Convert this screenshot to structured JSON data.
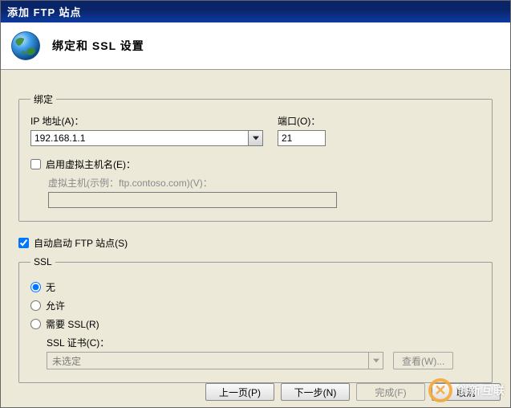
{
  "title": "添加 FTP 站点",
  "header": {
    "title": "绑定和 SSL 设置"
  },
  "binding": {
    "legend": "绑定",
    "ip_label": "IP 地址(A)：",
    "ip_value": "192.168.1.1",
    "port_label": "端口(O)：",
    "port_value": "21",
    "enable_vhost_label": "启用虚拟主机名(E)：",
    "vhost_label": "虚拟主机(示例：ftp.contoso.com)(V)：",
    "vhost_value": ""
  },
  "autostart": {
    "label": "自动启动 FTP 站点(S)"
  },
  "ssl": {
    "legend": "SSL",
    "none_label": "无",
    "allow_label": "允许",
    "require_label": "需要 SSL(R)",
    "cert_label": "SSL 证书(C)：",
    "cert_value": "未选定",
    "view_label": "查看(W)..."
  },
  "footer": {
    "prev": "上一页(P)",
    "next": "下一步(N)",
    "finish": "完成(F)",
    "cancel": "取消"
  },
  "watermark": {
    "text": "创新互联"
  }
}
